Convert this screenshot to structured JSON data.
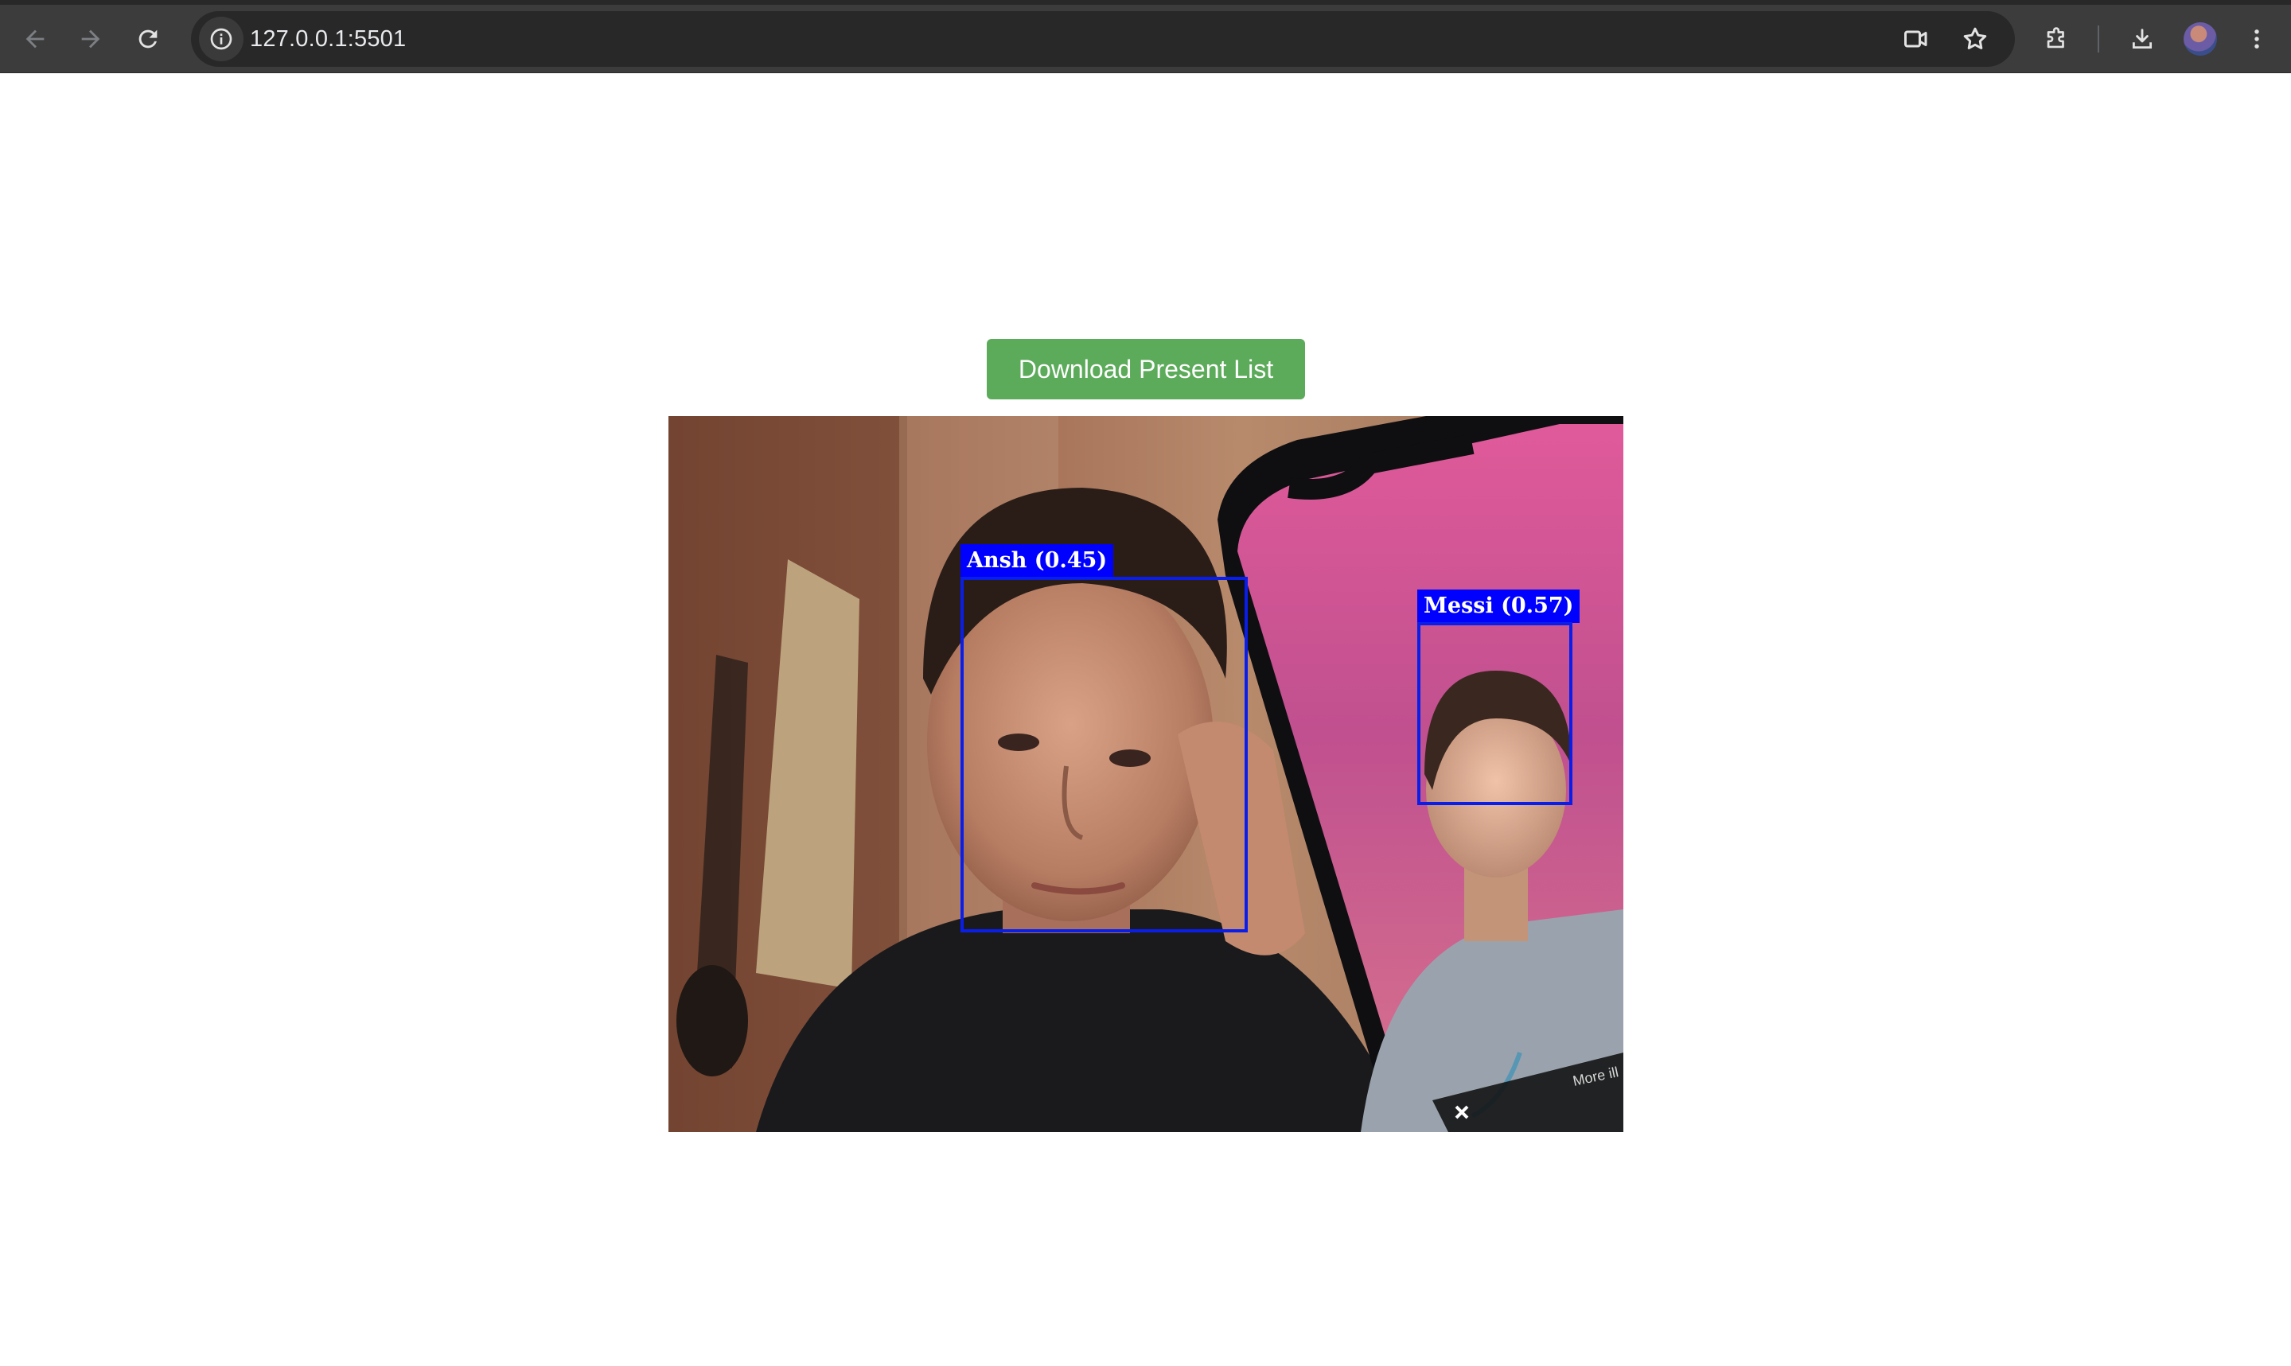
{
  "browser": {
    "url": "127.0.0.1:5501"
  },
  "page": {
    "download_button_label": "Download Present List",
    "detections": [
      {
        "label": "Ansh (0.45)"
      },
      {
        "label": "Messi (0.57)"
      }
    ],
    "phone_overlay_text": "More ill"
  },
  "colors": {
    "button_green": "#5cab5a",
    "detection_blue": "#0000ff",
    "toolbar_bg": "#3c3c3c",
    "omnibox_bg": "#282828"
  }
}
